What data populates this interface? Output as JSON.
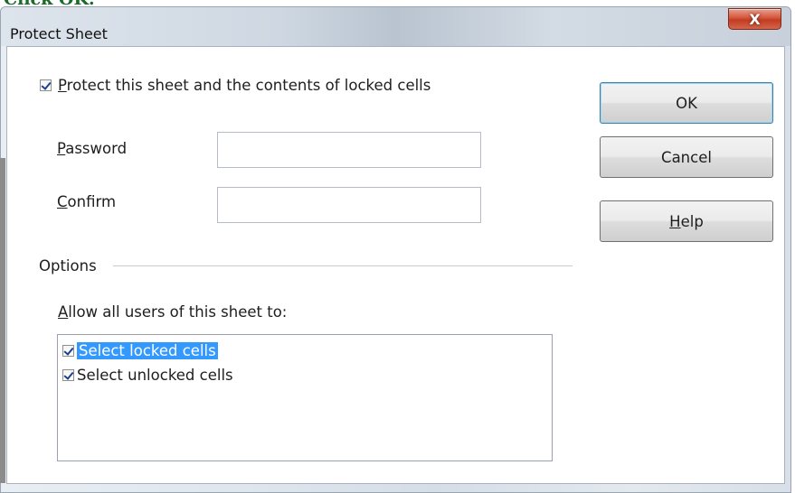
{
  "doc_text": "Click OK.",
  "window": {
    "title": "Protect Sheet",
    "close_glyph": "X"
  },
  "protect": {
    "checked": true,
    "label_access_key": "P",
    "label_rest": "rotect this sheet and the contents of locked cells"
  },
  "password": {
    "label_access_key": "P",
    "label_rest": "assword",
    "value": ""
  },
  "confirm": {
    "label_access_key": "C",
    "label_rest": "onfirm",
    "value": ""
  },
  "buttons": {
    "ok": "OK",
    "cancel": "Cancel",
    "help_access_key": "H",
    "help_rest": "elp"
  },
  "options": {
    "section_label": "Options",
    "allow_access_key": "A",
    "allow_rest": "llow all users of this sheet to:",
    "items": [
      {
        "label": "Select locked cells",
        "checked": true,
        "selected": true
      },
      {
        "label": "Select unlocked cells",
        "checked": true,
        "selected": false
      }
    ]
  },
  "icons": {
    "checkbox": "checkbox-checked-icon",
    "close": "close-icon"
  },
  "colors": {
    "selection": "#3399ff",
    "close_button": "#c13c22",
    "default_button_border": "#3c7fb1"
  }
}
